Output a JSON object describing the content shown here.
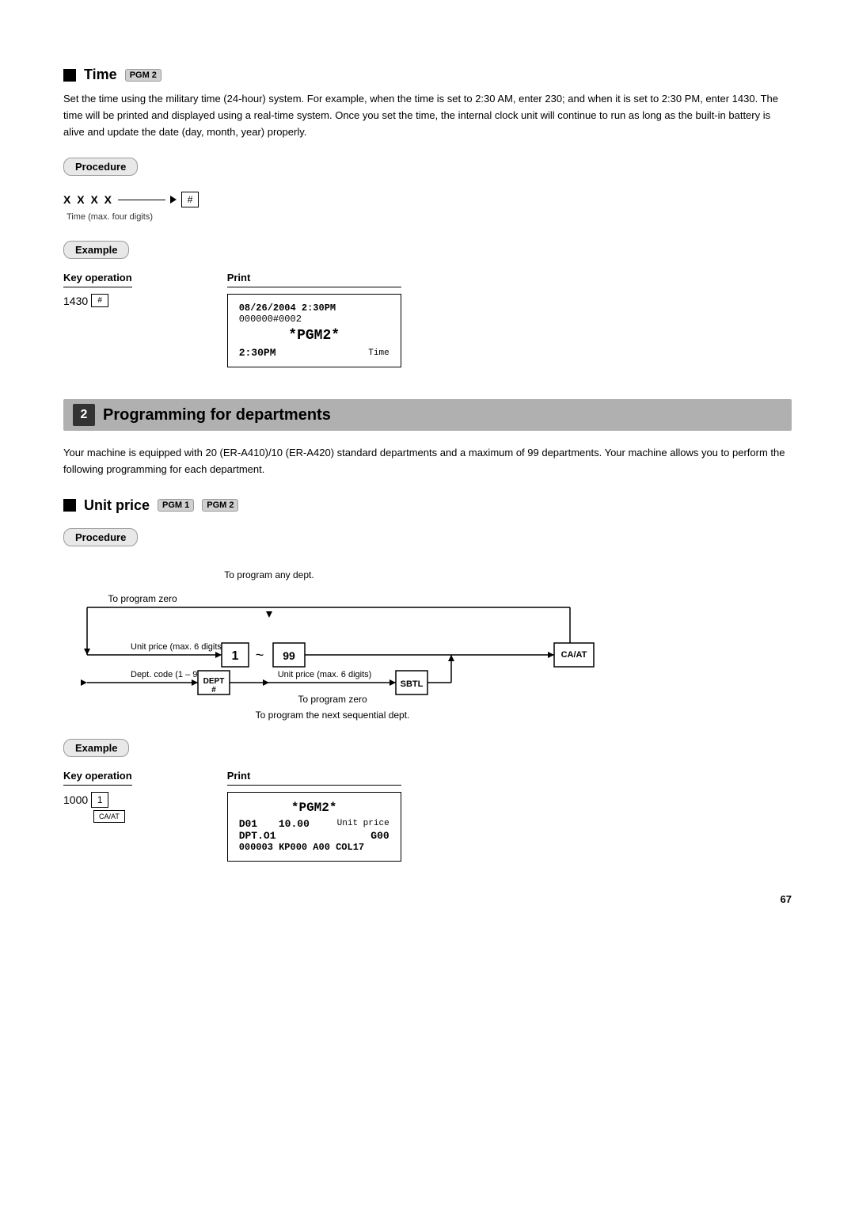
{
  "time_section": {
    "heading": "Time",
    "pgm_badge": "PGM 2",
    "body": "Set the time using the military time (24-hour) system. For example, when the time is set to 2:30 AM, enter 230; and when it is set to 2:30 PM, enter 1430. The time will be printed and displayed using a real-time system. Once you set the time, the internal clock unit will continue to run as long as the built-in battery is alive and update the date (day, month, year) properly.",
    "procedure_label": "Procedure",
    "procedure_input": "X X X X",
    "procedure_arrow": "→",
    "procedure_key": "#",
    "procedure_note": "Time (max. four digits)",
    "example_label": "Example",
    "key_operation_header": "Key operation",
    "print_header": "Print",
    "key_operation_value": "1430",
    "key_hash": "#",
    "receipt": {
      "line1": "08/26/2004  2:30PM",
      "line2": "000000#0002",
      "line3": "*PGM2*",
      "line4": "2:30PM",
      "annotation_time": "Time"
    }
  },
  "programming_section": {
    "number": "2",
    "title": "Programming for departments",
    "body": "Your machine is equipped with 20 (ER-A410)/10 (ER-A420) standard departments and a maximum of 99 departments. Your machine allows you to perform the following programming for each department."
  },
  "unit_price_section": {
    "heading": "Unit price",
    "pgm1_badge": "PGM 1",
    "pgm2_badge": "PGM 2",
    "procedure_label": "Procedure",
    "diagram": {
      "label_any_dept": "To program any dept.",
      "label_zero": "To program zero",
      "label_unit_price": "Unit price (max. 6 digits)",
      "label_dept_code": "Dept. code (1 – 99)",
      "label_unit_price2": "Unit price (max. 6 digits)",
      "label_zero2": "To program zero",
      "label_next": "To program the next sequential dept.",
      "key1": "1",
      "key_tilde": "~",
      "key99": "99",
      "key_caat": "CA/AT",
      "key_dept": "DEPT\n#",
      "key_sbtl": "SBTL"
    },
    "example_label": "Example",
    "key_operation_header": "Key operation",
    "print_header": "Print",
    "key_operation_value": "1000",
    "key_1": "1",
    "key_caat_small": "CA/AT",
    "receipt": {
      "line1": "*PGM2*",
      "line2": "D01               10.00",
      "line3": "DPT.O1            G00",
      "line4": "000003 KP000  A00  COL17",
      "annotation": "Unit price"
    }
  },
  "page_number": "67"
}
